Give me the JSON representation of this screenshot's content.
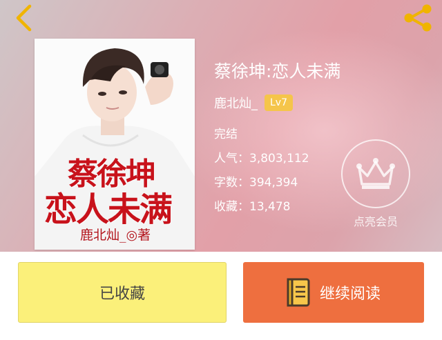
{
  "nav": {
    "back_icon": "chevron-left-icon",
    "share_icon": "share-icon"
  },
  "cover": {
    "title_line1": "蔡徐坤",
    "title_line2": "恋人未满",
    "author_credit": "鹿北灿_◎著"
  },
  "book": {
    "title": "蔡徐坤:恋人未满",
    "author": "鹿北灿_",
    "level": "Lv7",
    "status": "完结",
    "popularity": "人气：3,803,112",
    "word_count": "字数：394,394",
    "favorites": "收藏：13,478"
  },
  "vip": {
    "icon": "crown-icon",
    "label": "点亮会员"
  },
  "actions": {
    "collected_label": "已收藏",
    "read_label": "继续阅读",
    "read_icon": "book-icon"
  },
  "colors": {
    "accent_orange": "#ee6f3f",
    "collected_yellow": "#fbf07a",
    "badge_gold": "#f5c54a",
    "nav_icon": "#f0b400"
  }
}
